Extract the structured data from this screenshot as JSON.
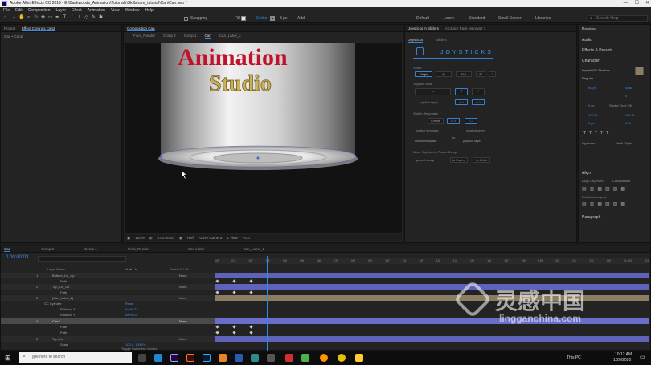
{
  "titlebar": {
    "title": "Adobe After Effects CC 2019 - E:\\Backwoods_Animation\\Tutorials\\Skillshare_tutorial\\Can\\Can.aep *",
    "controls": [
      "—",
      "☐",
      "✕"
    ]
  },
  "menubar": {
    "items": [
      "File",
      "Edit",
      "Composition",
      "Layer",
      "Effect",
      "Animation",
      "View",
      "Window",
      "Help"
    ]
  },
  "toolbar": {
    "snapping": "Snapping",
    "fill": "Fill",
    "stroke": "Stroke",
    "stroke_width": "3 px",
    "add": "Add:",
    "workspaces": [
      "Default",
      "Learn",
      "Standard",
      "Small Screen",
      "Libraries"
    ],
    "search_placeholder": "Search Help"
  },
  "project_panel": {
    "tabs": [
      "Project",
      "Effect Controls Can2"
    ],
    "breadcrumb": "Can • Can2"
  },
  "comp_panel": {
    "tab": "Composition Can",
    "subtabs": [
      "Final_Render",
      "Comp 2",
      "Comp 1",
      "Can",
      "Can_Label_2"
    ],
    "can_text_1": "Animation",
    "can_text_2": "Studio",
    "footer": {
      "zoom": "100%",
      "time": "0:00:00:03",
      "resolution": "Half",
      "camera": "Active Camera",
      "views": "1 View",
      "exposure": "+0.0"
    }
  },
  "joystick_panel": {
    "tabs": [
      "Joysticks 'n Sliders",
      "AEJuice Pack Manager 3"
    ],
    "subtabs": [
      "Joysticks",
      "Sliders"
    ],
    "brand": "JOYSTICKS",
    "setup_label": "Setup",
    "setup_buttons": [
      "Origin",
      "All",
      "Flat"
    ],
    "joystick_tools_label": "Joystick tools",
    "joystick_layer": "joystick layer",
    "switch_templates_label": "Switch Templates",
    "create_button": "Create",
    "switch_template_label": "switch template",
    "joystick_label": "joystick layer",
    "to_label": "to",
    "switch_template_select": "switch template",
    "joystick_select": "joystick layer",
    "move_label": "Move Joystick to Parent Comp",
    "parent_comp": "parent comp",
    "to_parent": "to Parent",
    "to_child": "to Child"
  },
  "right_sidebar": {
    "sections": [
      "Preview",
      "Audio",
      "Effects & Presets",
      "Character",
      "Align",
      "Paragraph"
    ],
    "font_name": "Imprint MT Shadow",
    "font_style": "Regular",
    "font_size": "90 px",
    "leading": "Auto",
    "tracking": "0",
    "stroke_px": "0 px",
    "stroke_over": "Stroke Over Fill",
    "vscale": "100 %",
    "hscale": "100 %",
    "baseline": "0 px",
    "tsume": "0 %",
    "ligatures": "Ligatures",
    "hindi_digits": "Hindi Digits",
    "align_to_label": "Align Layers to:",
    "align_to": "Composition",
    "distribute_label": "Distribute Layers:"
  },
  "timeline": {
    "tabs": [
      "Can",
      "Comp 2",
      "Comp 1",
      "Final_Render",
      "Can Label",
      "Can_Label_2"
    ],
    "timecode": "0:00:00:03",
    "columns": {
      "name": "Layer Name",
      "switches": "☀ ★ \\ fx",
      "parent": "Parent & Link"
    },
    "layers": [
      {
        "num": "1",
        "name": "Bottom_Lid_Up",
        "parent": "None"
      },
      {
        "num": "",
        "name": "Path",
        "parent": ""
      },
      {
        "num": "2",
        "name": "Top_Lid_Up",
        "parent": "None"
      },
      {
        "num": "",
        "name": "Path",
        "parent": ""
      },
      {
        "num": "3",
        "name": "[Can_Label_2]",
        "parent": "None"
      },
      {
        "num": "",
        "name": "CC Cylinder",
        "parent": "Reset"
      },
      {
        "num": "",
        "name": "Rotation X",
        "parent": "0x-90.0°"
      },
      {
        "num": "",
        "name": "Rotation Y",
        "parent": "0x+90.0°"
      },
      {
        "num": "4",
        "name": "Can2",
        "parent": "None"
      },
      {
        "num": "",
        "name": "Path",
        "parent": ""
      },
      {
        "num": "",
        "name": "Path",
        "parent": ""
      },
      {
        "num": "5",
        "name": "Top_Lid",
        "parent": "None"
      },
      {
        "num": "",
        "name": "Scale",
        "parent": "100.0, 100.0%"
      }
    ],
    "ruler": [
      "00f",
      "01f",
      "02f",
      "03f",
      "04f",
      "05f",
      "06f",
      "07f",
      "08f",
      "09f",
      "10f",
      "11f",
      "12f",
      "13f",
      "14f",
      "15f",
      "16f",
      "17f",
      "18f",
      "19f",
      "20f",
      "21f",
      "22f",
      "23f",
      "01:00f",
      "01f"
    ],
    "footer": "Toggle Switches / Modes"
  },
  "taskbar": {
    "search_placeholder": "Type here to search",
    "network": "This PC",
    "time": "10:12 AM",
    "date": "1/20/2020"
  },
  "watermark": {
    "cn": "灵感中国",
    "url": "lingganchina.com"
  },
  "colors": {
    "accent": "#2d8ceb",
    "purple_layer": "#5f63b8",
    "label_tan": "#8a7d61",
    "can_red": "#c0122b",
    "can_gold": "#c9b25a"
  }
}
